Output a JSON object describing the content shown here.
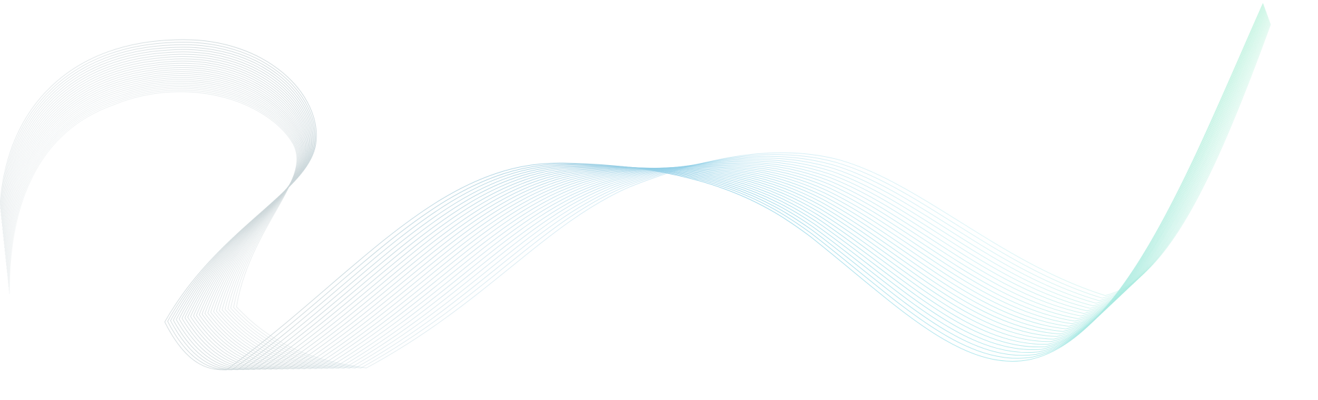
{
  "artwork": {
    "style": "decorative line-wave background",
    "ribbon_line_count": 26,
    "colors": {
      "background": "#ffffff",
      "line_gray": "#c9d4d7",
      "line_blue": "#8fcde6",
      "line_cyan": "#9fe3ea",
      "line_mint": "#9ff0c8"
    }
  }
}
